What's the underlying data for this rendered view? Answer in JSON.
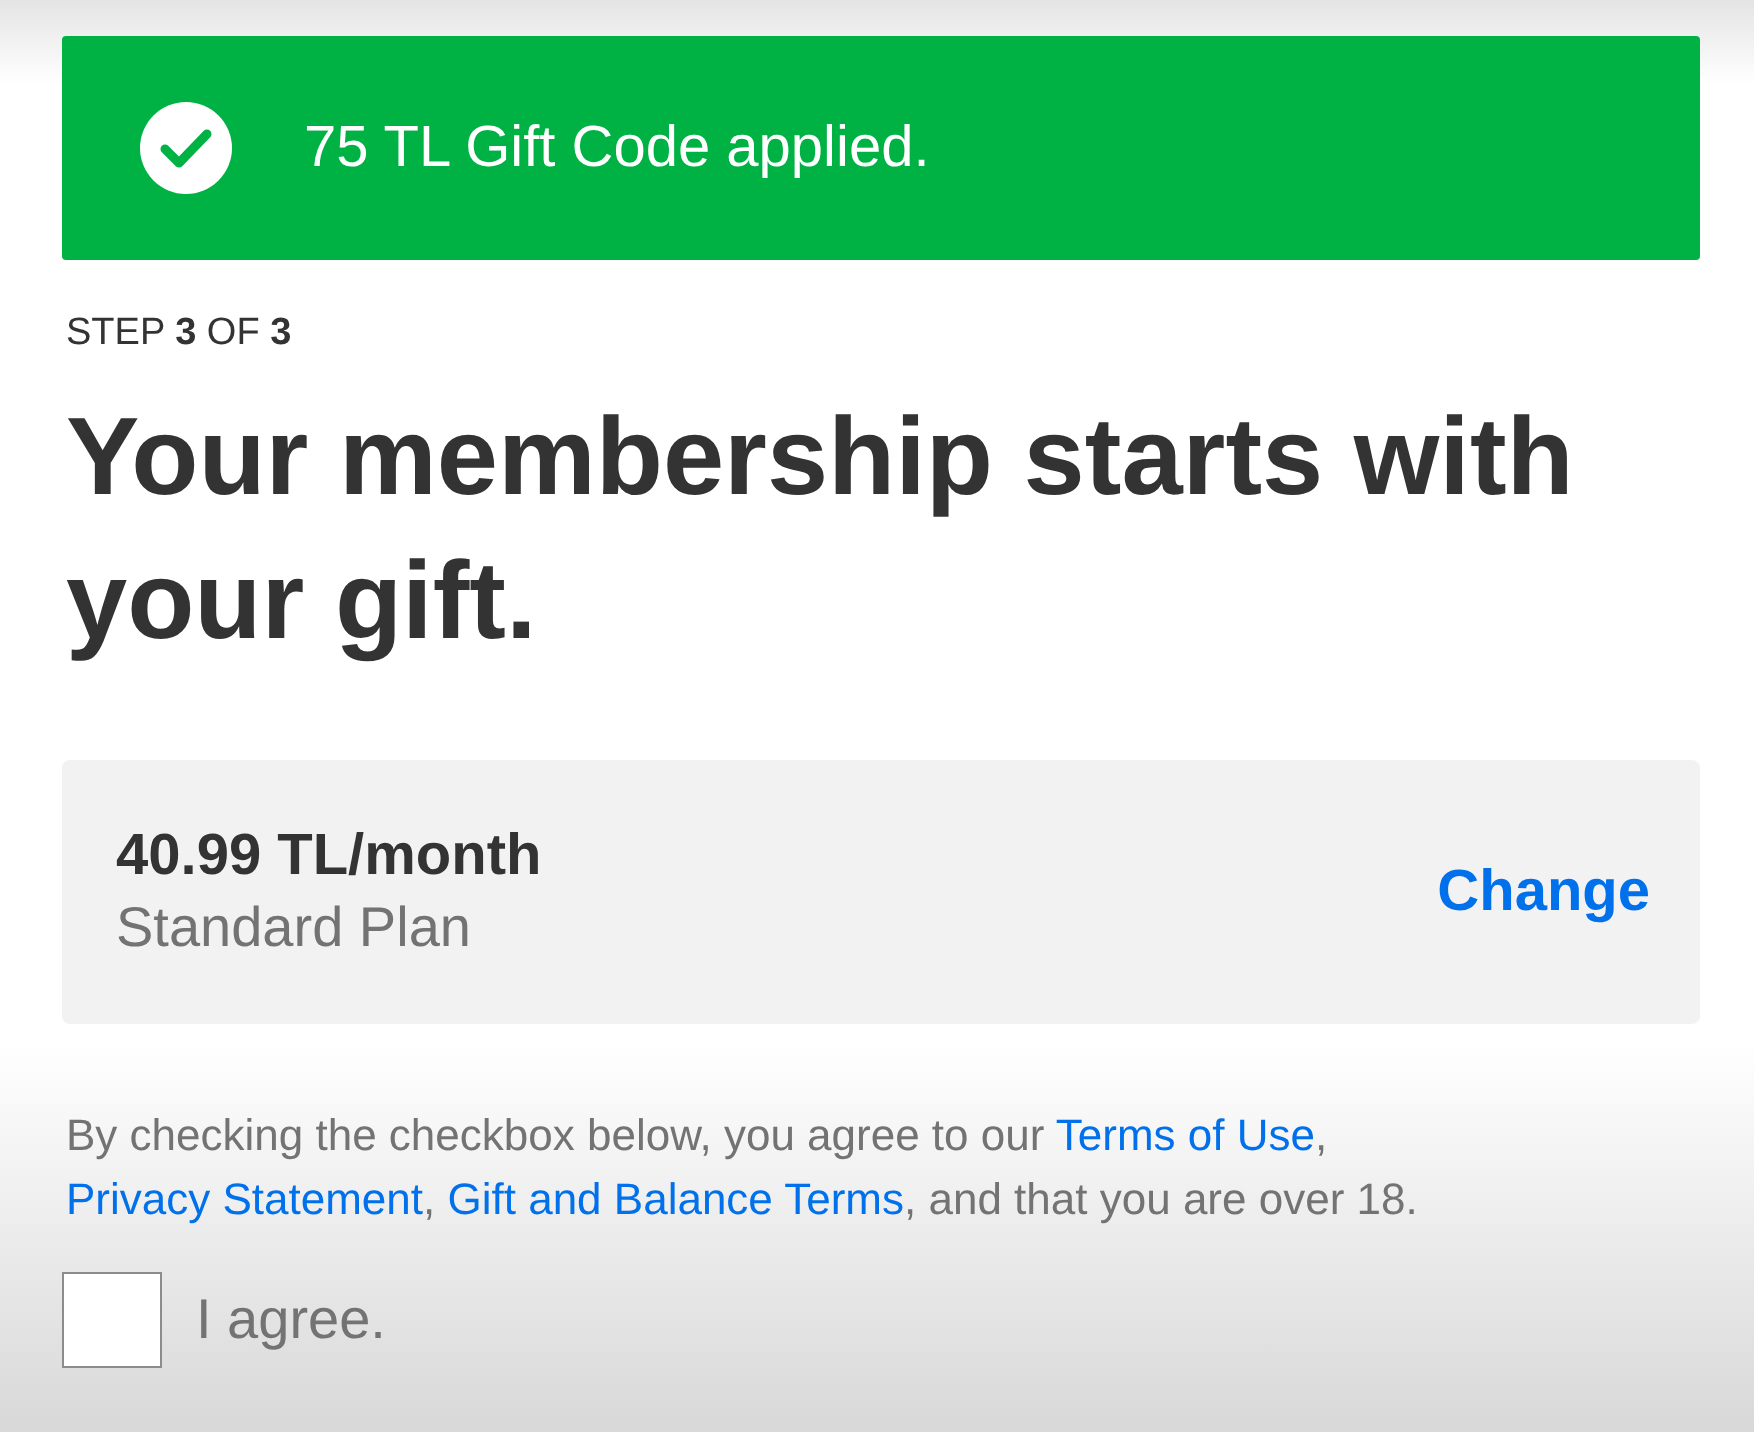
{
  "banner": {
    "text": "75 TL Gift Code applied."
  },
  "step": "STEP **3** OF **3**",
  "heading": "Your membership starts with your gift.",
  "plan": {
    "price": "40.99 TL/month",
    "name": "Standard Plan",
    "action": "Change"
  },
  "terms": [
    {
      "kind": "text",
      "text": "By checking the checkbox below, you agree to our "
    },
    {
      "kind": "link",
      "text": "Terms of Use"
    },
    {
      "kind": "text",
      "text": ", "
    },
    {
      "kind": "link",
      "text": "Privacy Statement"
    },
    {
      "kind": "text",
      "text": ", "
    },
    {
      "kind": "link",
      "text": "Gift and Balance Terms"
    },
    {
      "kind": "text",
      "text": ", and that you are over 18."
    }
  ],
  "agreement": {
    "label": "I agree.",
    "checked": false
  }
}
